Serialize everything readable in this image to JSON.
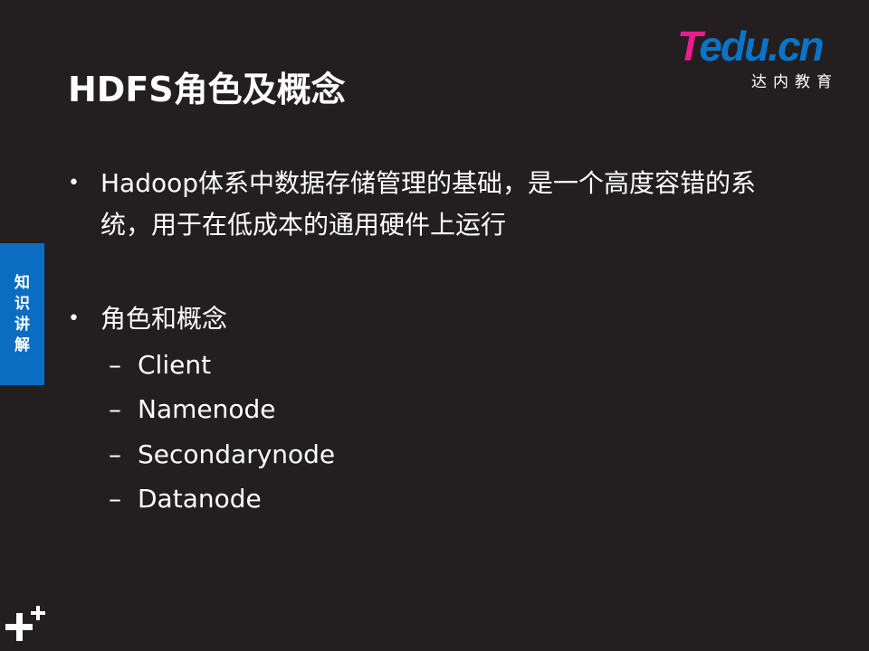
{
  "slide": {
    "title": "HDFS角色及概念",
    "logo": {
      "brand_t": "T",
      "brand_rest": "edu.cn",
      "subtitle": "达内教育"
    },
    "side_tab": [
      "知",
      "识",
      "讲",
      "解"
    ],
    "bullets": [
      {
        "text": "Hadoop体系中数据存储管理的基础，是一个高度容错的系统，用于在低成本的通用硬件上运行"
      },
      {
        "text": "角色和概念",
        "sub_items": [
          "Client",
          "Namenode",
          "Secondarynode",
          "Datanode"
        ]
      }
    ],
    "bullet_symbol": "•",
    "dash_symbol": "–",
    "colors": {
      "background": "#231f20",
      "side_tab": "#0a6dc2",
      "logo_pink": "#ec1c8c",
      "logo_blue": "#0a74c8"
    },
    "corner_icon": "plus-icon"
  }
}
